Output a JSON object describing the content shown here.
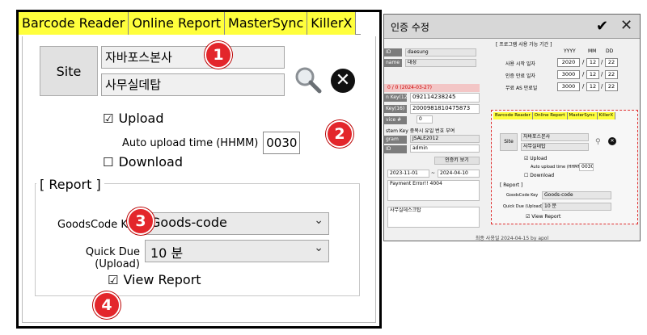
{
  "tabs": [
    {
      "label": "Barcode Reader"
    },
    {
      "label": "Online Report"
    },
    {
      "label": "MasterSync"
    },
    {
      "label": "KillerX"
    }
  ],
  "site": {
    "button_label": "Site",
    "name": "자바포스본사",
    "dept": "사무실데탑"
  },
  "sync": {
    "upload_label": "Upload",
    "upload_checked": "☑",
    "auto_time_label": "Auto upload time (HHMM)",
    "auto_time_value": "0030",
    "download_label": "Download",
    "download_checked": "☐"
  },
  "report": {
    "title": "[ Report ]",
    "goods_label": "GoodsCode Key",
    "goods_value": "Goods-code",
    "due_label": "Quick Due (Upload)",
    "due_value": "10 분",
    "view_label": "View Report",
    "view_checked": "☑"
  },
  "badges": [
    "1",
    "2",
    "3",
    "4"
  ],
  "window": {
    "title": "인증 수정",
    "left_fields": [
      {
        "label": "ID",
        "value": "daesung"
      },
      {
        "label": "name",
        "value": "대성"
      }
    ],
    "red_row": "0 / 0 (2024-03-27)",
    "keys": [
      {
        "label": "n Key(12)",
        "value": "092114238245"
      },
      {
        "label": "Key(16)",
        "value": "2000981810475873"
      },
      {
        "label": "vice #",
        "value": "0"
      }
    ],
    "system_key_label": "stem Key 중복시 유일 번호 부여",
    "program": {
      "label": "gram",
      "value": "JSALE2012"
    },
    "admin": {
      "label": "ID",
      "value": "admin"
    },
    "note_label": "",
    "auth_button": "인증키 보기",
    "date_from": "2023-11-01",
    "date_to": "2024-04-10",
    "memo1": "Payment Error!! 4004",
    "memo2": "사무실데스크탑",
    "period_title": "[ 프로그램 사용 가능 기간 ]",
    "period_headers": [
      "YYYY",
      "MM",
      "DD"
    ],
    "periods": [
      {
        "label": "사용 시작 일자",
        "y": "2020",
        "m": "12",
        "d": "22"
      },
      {
        "label": "인증 만료 일자",
        "y": "3000",
        "m": "12",
        "d": "22"
      },
      {
        "label": "무료 AS 만료일",
        "y": "3000",
        "m": "12",
        "d": "22"
      }
    ],
    "status": "최종 사용일 2024-04-15 by apol"
  },
  "mini": {
    "tabs": [
      "Barcode Reader",
      "Online Report",
      "MasterSync",
      "KillerX"
    ],
    "site_label": "Site",
    "site_name": "자바포스본사",
    "site_dept": "사무실데탑",
    "upload": "☑ Upload",
    "auto_time": "Auto upload time (HHMM)",
    "auto_value": "0030",
    "download": "☐ Download",
    "report_title": "[ Report ]",
    "goods_label": "GoodsCode Key",
    "goods_value": "Goods-code",
    "due_label": "Quick Due (Upload)",
    "due_value": "10 분",
    "view": "☑ View Report"
  }
}
